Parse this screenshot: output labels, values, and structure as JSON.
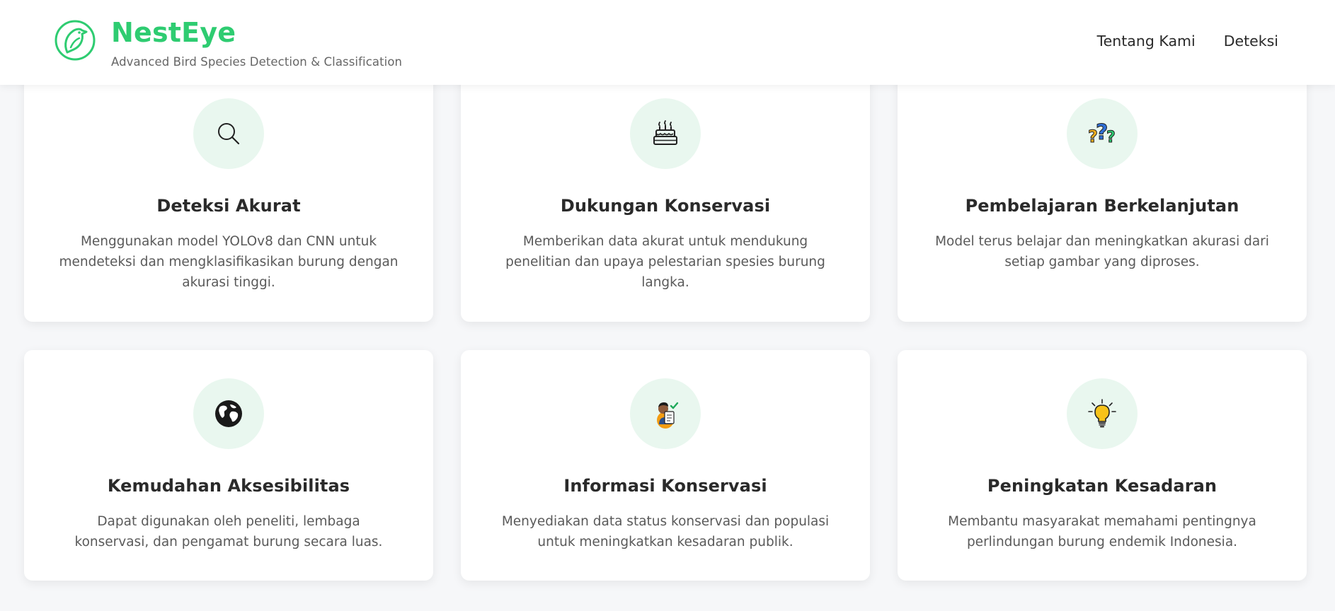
{
  "header": {
    "brand_name": "NestEye",
    "tagline": "Advanced Bird Species Detection & Classification",
    "logo_icon": "bird-logo-icon",
    "nav": [
      {
        "label": "Tentang Kami"
      },
      {
        "label": "Deteksi"
      }
    ]
  },
  "colors": {
    "brand_green": "#2ecc71",
    "icon_bg": "#e9f7ef",
    "page_bg": "#f6f7f9"
  },
  "features": [
    {
      "icon": "search-icon",
      "title": "Deteksi Akurat",
      "desc": "Menggunakan model YOLOv8 dan CNN untuk mendeteksi dan mengklasifikasikan burung dengan akurasi tinggi."
    },
    {
      "icon": "cake-icon",
      "title": "Dukungan Konservasi",
      "desc": "Memberikan data akurat untuk mendukung penelitian dan upaya pelestarian spesies burung langka."
    },
    {
      "icon": "question-marks-icon",
      "title": "Pembelajaran Berkelanjutan",
      "desc": "Model terus belajar dan meningkatkan akurasi dari setiap gambar yang diproses."
    },
    {
      "icon": "globe-icon",
      "title": "Kemudahan Aksesibilitas",
      "desc": "Dapat digunakan oleh peneliti, lembaga konservasi, dan pengamat burung secara luas."
    },
    {
      "icon": "person-document-icon",
      "title": "Informasi Konservasi",
      "desc": "Menyediakan data status konservasi dan populasi untuk meningkatkan kesadaran publik."
    },
    {
      "icon": "lightbulb-icon",
      "title": "Peningkatan Kesadaran",
      "desc": "Membantu masyarakat memahami pentingnya perlindungan burung endemik Indonesia."
    }
  ]
}
